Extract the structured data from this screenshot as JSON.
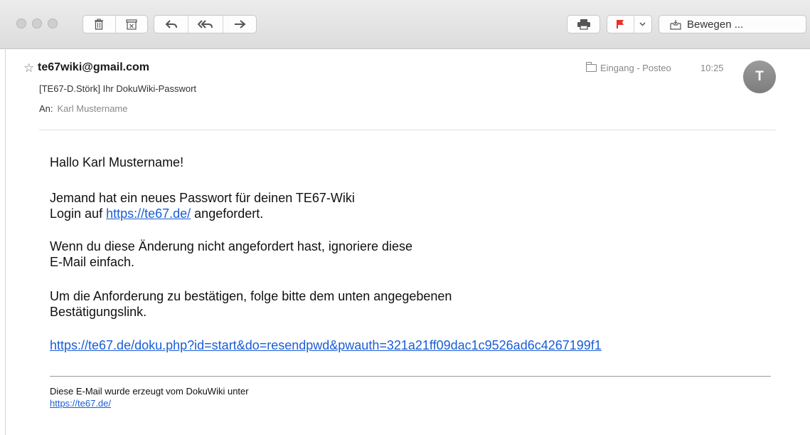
{
  "toolbar": {
    "move_label": "Bewegen ..."
  },
  "header": {
    "from": "te67wiki@gmail.com",
    "subject": "[TE67-D.Störk] Ihr DokuWiki-Passwort",
    "to_label": "An:",
    "to_name": "Karl Mustername",
    "mailbox": "Eingang - Posteo",
    "time": "10:25",
    "avatar_initial": "T"
  },
  "message": {
    "greeting": "Hallo Karl Mustername!",
    "p1_line1": "Jemand hat ein neues Passwort für deinen TE67-Wiki",
    "p1_prefix": "Login auf ",
    "p1_link": "https://te67.de/",
    "p1_suffix": " angefordert.",
    "p2_line1": "Wenn du diese Änderung nicht angefordert hast, ignoriere diese",
    "p2_line2": "E-Mail einfach.",
    "p3_line1": "Um die Anforderung zu bestätigen, folge bitte dem unten angegebenen",
    "p3_line2": "Bestätigungslink.",
    "confirm_link": "https://te67.de/doku.php?id=start&do=resendpwd&pwauth=321a21ff09dac1c9526ad6c4267199f1",
    "footer_line": "Diese E-Mail wurde erzeugt vom DokuWiki unter",
    "footer_link": "https://te67.de/"
  },
  "colors": {
    "link": "#1a5dd6",
    "flag": "#e8322b",
    "avatar": "#8a8a8a"
  }
}
